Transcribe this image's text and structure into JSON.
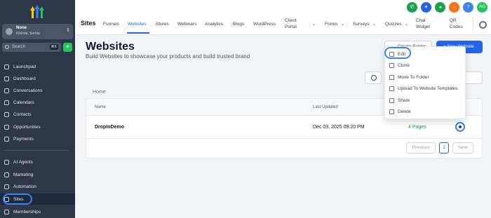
{
  "sidebar": {
    "location": {
      "name": "None",
      "sub": "Kikinda, Serbia"
    },
    "search": {
      "label": "Search",
      "shortcut": "⌘K"
    },
    "plus_label": "+",
    "items": [
      {
        "label": "Launchpad"
      },
      {
        "label": "Dashboard"
      },
      {
        "label": "Conversations"
      },
      {
        "label": "Calendars"
      },
      {
        "label": "Contacts"
      },
      {
        "label": "Opportunities"
      },
      {
        "label": "Payments"
      },
      {
        "label": "AI Agents"
      },
      {
        "label": "Marketing"
      },
      {
        "label": "Automation"
      },
      {
        "label": "Sites"
      },
      {
        "label": "Memberships"
      }
    ]
  },
  "topbar": {
    "title": "Sites",
    "tabs": [
      {
        "label": "Funnels"
      },
      {
        "label": "Websites"
      },
      {
        "label": "Stores"
      },
      {
        "label": "Webinars"
      },
      {
        "label": "Analytics"
      },
      {
        "label": "Blogs"
      },
      {
        "label": "WordPress"
      },
      {
        "label": "Client",
        "label2": "Portal"
      },
      {
        "label": "Forms"
      },
      {
        "label": "Surveys"
      },
      {
        "label": "Quizzes"
      },
      {
        "label": "Chat",
        "label2": "Widget"
      },
      {
        "label": "QR",
        "label2": "Codes"
      }
    ],
    "avatar": "AG",
    "icon_colors": [
      "#16a34a",
      "#2563eb",
      "#16a34a",
      "#f97316",
      "#3b82f6"
    ]
  },
  "main": {
    "heading": "Websites",
    "subtitle": "Build Websites to showcase your products and build trusted brand",
    "create_folder": "Create Folder",
    "new_website": "+ New Website",
    "breadcrumb": "Home",
    "columns": [
      "Name",
      "Last Updated"
    ],
    "rows": [
      {
        "name": "DropInDemo",
        "updated": "Dec 03, 2025 09:20 PM",
        "pages": "4 Pages"
      }
    ],
    "pagination": {
      "previous": "Previous",
      "current": "1",
      "next": "Next"
    }
  },
  "menu": {
    "items": [
      {
        "label": "Edit"
      },
      {
        "label": "Clone"
      },
      {
        "label": "Move To Folder"
      },
      {
        "label": "Upload To Website Templates"
      },
      {
        "label": "Share"
      },
      {
        "label": "Delete"
      }
    ]
  },
  "colors": {
    "accent": "#2563eb",
    "sidebar_bg": "#2d3748",
    "success": "#16a34a"
  }
}
